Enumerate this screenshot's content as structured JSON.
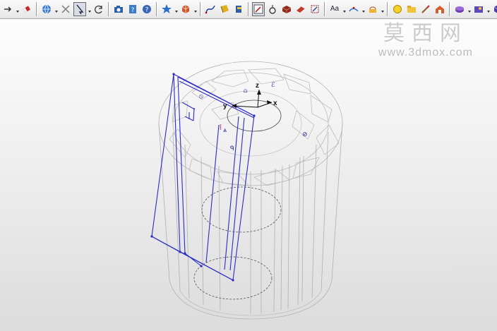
{
  "toolbar": {
    "groups": [
      [
        {
          "icon": "arrow-icon",
          "dropdown": true
        },
        {
          "icon": "eraser-icon",
          "dropdown": false
        }
      ],
      [
        {
          "icon": "globe-icon",
          "dropdown": true
        },
        {
          "icon": "cross-icon",
          "dropdown": false
        },
        {
          "icon": "select-pointer-icon",
          "dropdown": true,
          "active": true
        },
        {
          "icon": "rotate-icon",
          "dropdown": false
        }
      ],
      [
        {
          "icon": "camera-icon",
          "dropdown": false
        },
        {
          "icon": "help-book-icon",
          "dropdown": false
        },
        {
          "icon": "help-icon",
          "dropdown": false
        }
      ],
      [
        {
          "icon": "star-icon",
          "dropdown": true
        },
        {
          "icon": "cube-icon",
          "dropdown": true
        }
      ],
      [
        {
          "icon": "curve-icon",
          "dropdown": false
        },
        {
          "icon": "wrap-icon",
          "dropdown": false
        },
        {
          "icon": "extrude-icon",
          "dropdown": false
        }
      ],
      [
        {
          "icon": "sketch-icon",
          "dropdown": false,
          "active": true
        },
        {
          "icon": "trim-icon",
          "dropdown": false
        },
        {
          "icon": "solid-box-icon",
          "dropdown": false
        },
        {
          "icon": "fillet-icon",
          "dropdown": false
        },
        {
          "icon": "transform-icon",
          "dropdown": false
        }
      ],
      [
        {
          "icon": "text-icon",
          "text": "Aa",
          "dropdown": true
        },
        {
          "icon": "dimension-icon",
          "dropdown": true
        },
        {
          "icon": "pattern-icon",
          "dropdown": true
        }
      ],
      [
        {
          "icon": "light-bulb-icon",
          "dropdown": false
        },
        {
          "icon": "folder-icon",
          "dropdown": false
        },
        {
          "icon": "paint-brush-icon",
          "dropdown": false
        },
        {
          "icon": "house-icon",
          "dropdown": false
        }
      ],
      [
        {
          "icon": "render-icon",
          "dropdown": true
        },
        {
          "icon": "material-icon",
          "dropdown": true
        },
        {
          "icon": "view-cube-icon",
          "dropdown": true
        }
      ]
    ]
  },
  "viewport": {
    "triad": {
      "x_label": "x",
      "y_label": "y",
      "z_label": "z"
    }
  },
  "watermark": {
    "logo_text": "莫西网",
    "site": "www.3dmox.com"
  },
  "colors": {
    "sketch_blue": "#2b2bc6",
    "wire_gray": "#9a9a9a",
    "annotation_navy": "#1b1b8c",
    "annotation_magenta": "#b0307a"
  }
}
